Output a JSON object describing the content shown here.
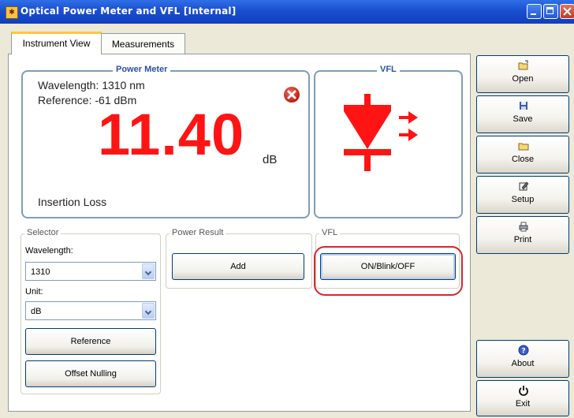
{
  "window": {
    "title": "Optical Power Meter and VFL [Internal]"
  },
  "tabs": [
    {
      "label": "Instrument View"
    },
    {
      "label": "Measurements"
    }
  ],
  "power_meter": {
    "title": "Power Meter",
    "wavelength_text": "Wavelength: 1310 nm",
    "reference_text": "Reference: -61 dBm",
    "value": "11.40",
    "unit": "dB",
    "mode": "Insertion Loss",
    "status_icon": "error-icon"
  },
  "vfl_panel": {
    "title": "VFL",
    "icon": "laser-diode-icon"
  },
  "selector": {
    "title": "Selector",
    "wavelength_label": "Wavelength:",
    "wavelength_value": "1310",
    "unit_label": "Unit:",
    "unit_value": "dB",
    "reference_button": "Reference",
    "offset_button": "Offset Nulling"
  },
  "power_result": {
    "title": "Power Result",
    "add_button": "Add"
  },
  "vfl_control": {
    "title": "VFL",
    "button": "ON/Blink/OFF"
  },
  "sidebar": {
    "open": "Open",
    "save": "Save",
    "close": "Close",
    "setup": "Setup",
    "print": "Print",
    "about": "About",
    "exit": "Exit"
  },
  "colors": {
    "reading": "#ff1414",
    "highlight": "#d8262d",
    "title_bar": "#1a4fd0",
    "panel_border": "#7f9db9"
  }
}
